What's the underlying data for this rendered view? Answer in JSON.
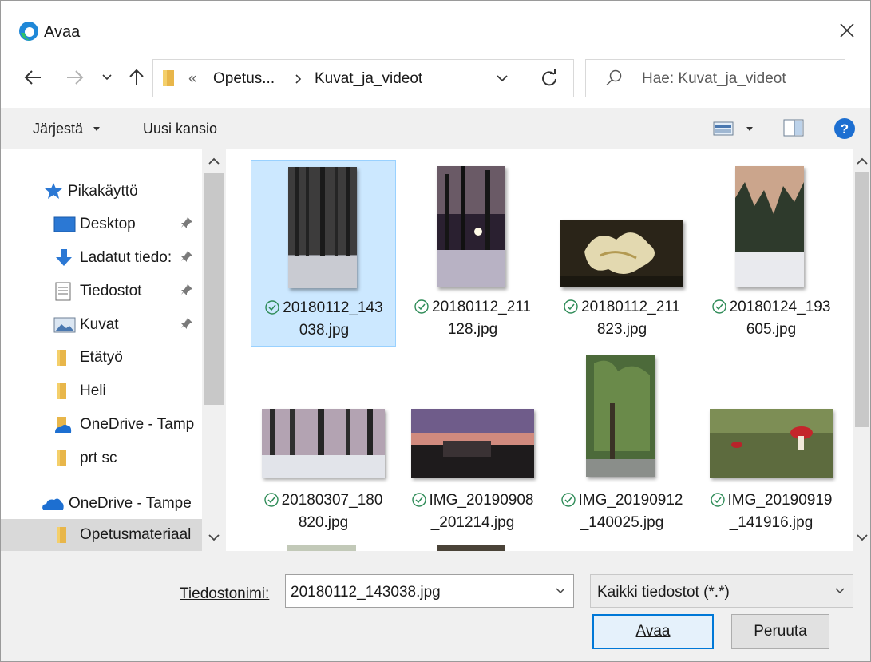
{
  "window": {
    "title": "Avaa"
  },
  "address": {
    "overflow_symbol": "«",
    "crumbs": [
      "Opetus...",
      "Kuvat_ja_videot"
    ]
  },
  "search": {
    "placeholder": "Hae: Kuvat_ja_videot"
  },
  "commands": {
    "organize": "Järjestä",
    "new_folder": "Uusi kansio"
  },
  "sidebar": {
    "items": [
      {
        "label": "Pikakäyttö"
      },
      {
        "label": "Desktop"
      },
      {
        "label": "Ladatut tiedo:"
      },
      {
        "label": "Tiedostot"
      },
      {
        "label": "Kuvat"
      },
      {
        "label": "Etätyö"
      },
      {
        "label": "Heli"
      },
      {
        "label": "OneDrive - Tamp"
      },
      {
        "label": "prt sc"
      },
      {
        "label": "OneDrive - Tampe"
      },
      {
        "label": "Opetusmateriaal"
      }
    ]
  },
  "files": [
    {
      "line1": "20180112_143",
      "line2": "038.jpg"
    },
    {
      "line1": "20180112_211",
      "line2": "128.jpg"
    },
    {
      "line1": "20180112_211",
      "line2": "823.jpg"
    },
    {
      "line1": "20180124_193",
      "line2": "605.jpg"
    },
    {
      "line1": "20180307_180",
      "line2": "820.jpg"
    },
    {
      "line1": "IMG_20190908",
      "line2": "_201214.jpg"
    },
    {
      "line1": "IMG_20190912",
      "line2": "_140025.jpg"
    },
    {
      "line1": "IMG_20190919",
      "line2": "_141916.jpg"
    }
  ],
  "footer": {
    "filename_label": "Tiedostonimi:",
    "filename_value": "20180112_143038.jpg",
    "filter_value": "Kaikki tiedostot (*.*)",
    "open_label": "Avaa",
    "cancel_label": "Peruuta"
  },
  "colors": {
    "accent": "#0078d7",
    "selection": "#cce8ff",
    "sync_ok": "#2e8b57"
  }
}
